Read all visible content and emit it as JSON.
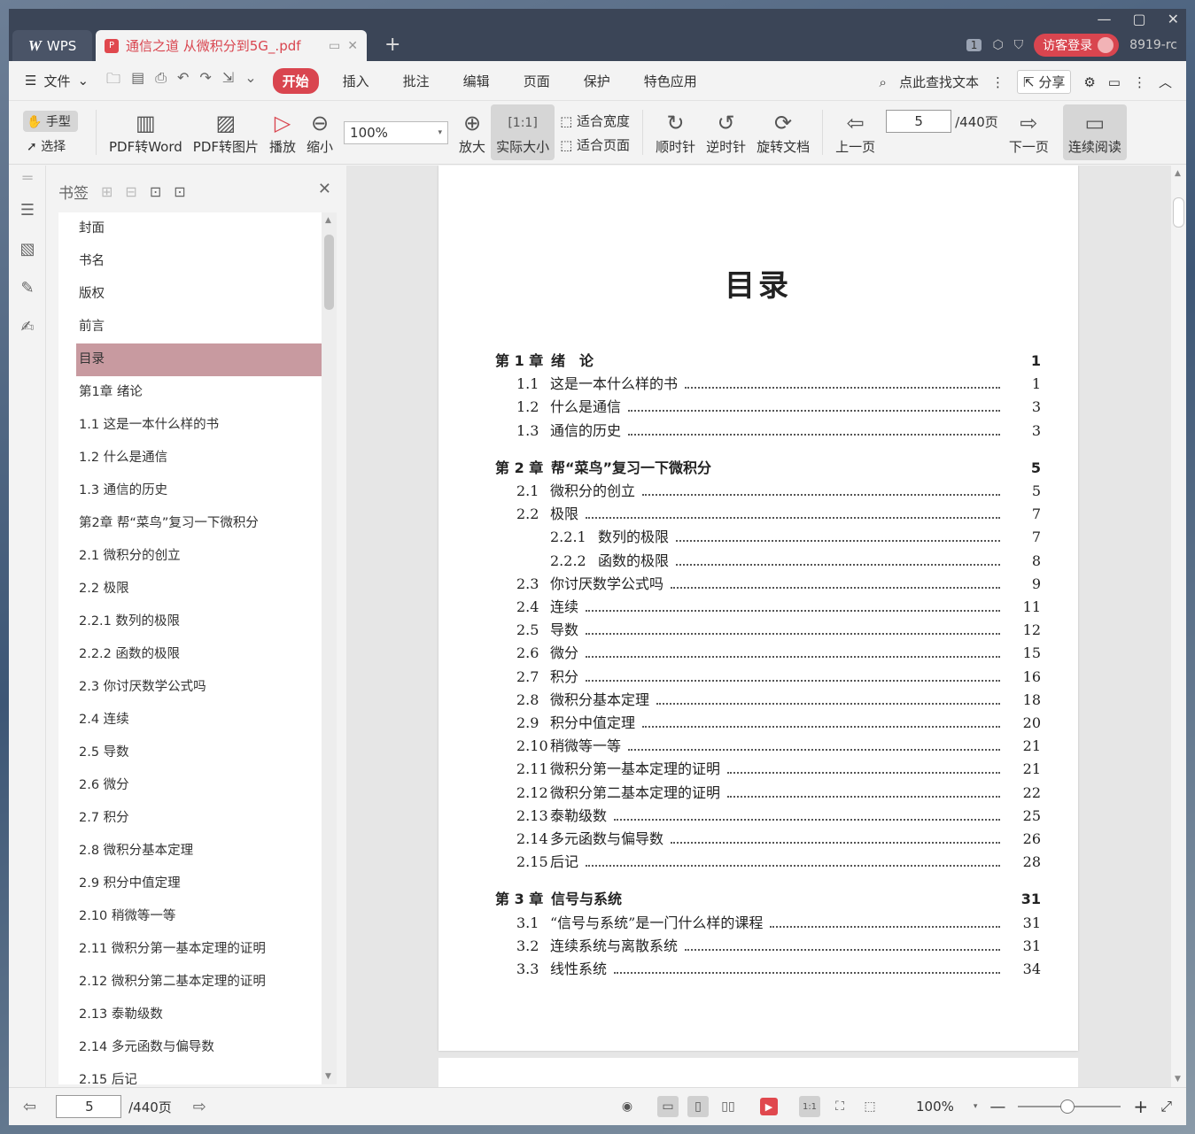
{
  "titlebar": {
    "app_label": "WPS",
    "app_logo": "W",
    "doc_tab_title": "通信之道 从微积分到5G_.pdf",
    "badge": "1",
    "login_label": "访客登录",
    "user_label": "8919-rc"
  },
  "menubar": {
    "file_label": "文件",
    "items": [
      "开始",
      "插入",
      "批注",
      "编辑",
      "页面",
      "保护",
      "特色应用"
    ],
    "search_label": "点此查找文本",
    "share_label": "分享"
  },
  "ribbon": {
    "hand_label": "手型",
    "select_label": "选择",
    "pdf_word": "PDF转Word",
    "pdf_image": "PDF转图片",
    "play": "播放",
    "zoom_out": "缩小",
    "zoom_value": "100%",
    "zoom_in": "放大",
    "actual_size": "实际大小",
    "fit_width": "适合宽度",
    "fit_page": "适合页面",
    "clockwise": "顺时针",
    "counter_clockwise": "逆时针",
    "rotate_doc": "旋转文档",
    "prev_page": "上一页",
    "page_value": "5",
    "page_total": "/440页",
    "next_page": "下一页",
    "continuous": "连续阅读"
  },
  "bookmarks": {
    "title": "书签",
    "items": [
      "封面",
      "书名",
      "版权",
      "前言",
      "目录",
      "第1章  绪论",
      "1.1  这是一本什么样的书",
      "1.2  什么是通信",
      "1.3  通信的历史",
      "第2章  帮“菜鸟”复习一下微积分",
      "2.1  微积分的创立",
      "2.2  极限",
      "2.2.1  数列的极限",
      "2.2.2  函数的极限",
      "2.3  你讨厌数学公式吗",
      "2.4  连续",
      "2.5  导数",
      "2.6  微分",
      "2.7  积分",
      "2.8  微积分基本定理",
      "2.9  积分中值定理",
      "2.10  稍微等一等",
      "2.11  微积分第一基本定理的证明",
      "2.12  微积分第二基本定理的证明",
      "2.13  泰勒级数",
      "2.14  多元函数与偏导数",
      "2.15  后记"
    ],
    "selected": "目录"
  },
  "document": {
    "toc_title": "目录",
    "entries": [
      {
        "num": "第 1 章",
        "text": "绪　论",
        "page": "1",
        "level": "chap"
      },
      {
        "num": "1.1",
        "text": "这是一本什么样的书",
        "page": "1",
        "level": "sec"
      },
      {
        "num": "1.2",
        "text": "什么是通信",
        "page": "3",
        "level": "sec"
      },
      {
        "num": "1.3",
        "text": "通信的历史",
        "page": "3",
        "level": "sec"
      },
      {
        "num": "第 2 章",
        "text": "帮“菜鸟”复习一下微积分",
        "page": "5",
        "level": "chap"
      },
      {
        "num": "2.1",
        "text": "微积分的创立",
        "page": "5",
        "level": "sec"
      },
      {
        "num": "2.2",
        "text": "极限",
        "page": "7",
        "level": "sec"
      },
      {
        "num": "2.2.1",
        "text": "数列的极限",
        "page": "7",
        "level": "sub"
      },
      {
        "num": "2.2.2",
        "text": "函数的极限",
        "page": "8",
        "level": "sub"
      },
      {
        "num": "2.3",
        "text": "你讨厌数学公式吗",
        "page": "9",
        "level": "sec"
      },
      {
        "num": "2.4",
        "text": "连续",
        "page": "11",
        "level": "sec"
      },
      {
        "num": "2.5",
        "text": "导数",
        "page": "12",
        "level": "sec"
      },
      {
        "num": "2.6",
        "text": "微分",
        "page": "15",
        "level": "sec"
      },
      {
        "num": "2.7",
        "text": "积分",
        "page": "16",
        "level": "sec"
      },
      {
        "num": "2.8",
        "text": "微积分基本定理",
        "page": "18",
        "level": "sec"
      },
      {
        "num": "2.9",
        "text": "积分中值定理",
        "page": "20",
        "level": "sec"
      },
      {
        "num": "2.10",
        "text": "稍微等一等",
        "page": "21",
        "level": "sec"
      },
      {
        "num": "2.11",
        "text": "微积分第一基本定理的证明",
        "page": "21",
        "level": "sec"
      },
      {
        "num": "2.12",
        "text": "微积分第二基本定理的证明",
        "page": "22",
        "level": "sec"
      },
      {
        "num": "2.13",
        "text": "泰勒级数",
        "page": "25",
        "level": "sec"
      },
      {
        "num": "2.14",
        "text": "多元函数与偏导数",
        "page": "26",
        "level": "sec"
      },
      {
        "num": "2.15",
        "text": "后记",
        "page": "28",
        "level": "sec"
      },
      {
        "num": "第 3 章",
        "text": "信号与系统",
        "page": "31",
        "level": "chap"
      },
      {
        "num": "3.1",
        "text": "“信号与系统”是一门什么样的课程",
        "page": "31",
        "level": "sec"
      },
      {
        "num": "3.2",
        "text": "连续系统与离散系统",
        "page": "31",
        "level": "sec"
      },
      {
        "num": "3.3",
        "text": "线性系统",
        "page": "34",
        "level": "sec"
      }
    ]
  },
  "statusbar": {
    "page_value": "5",
    "page_total": "/440页",
    "zoom_value": "100%"
  },
  "colors": {
    "accent": "#d9454f",
    "titlebar": "#3b4557",
    "selected_bookmark": "#c89aa0"
  }
}
